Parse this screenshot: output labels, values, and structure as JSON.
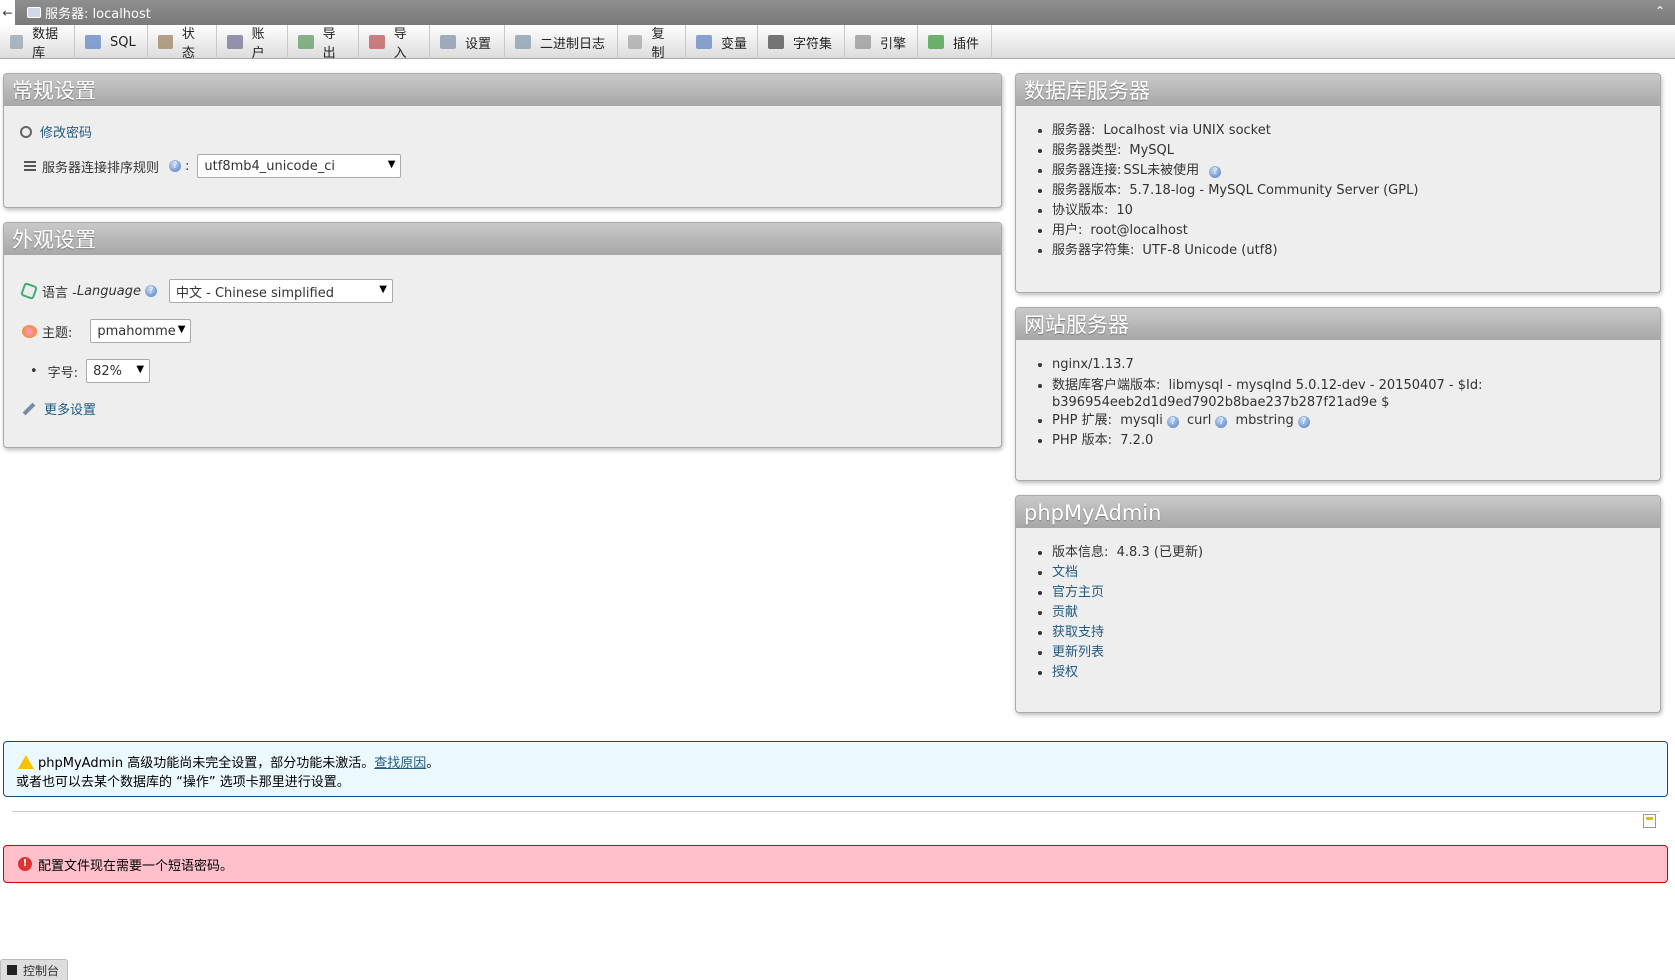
{
  "topbar": {
    "back_glyph": "←",
    "title": "服务器: localhost",
    "collapse_glyph": "⌃"
  },
  "menu": [
    {
      "label": "数据库",
      "icon": "database-icon",
      "color": "#9aa6b4"
    },
    {
      "label": "SQL",
      "icon": "sql-icon",
      "color": "#6a8bc5"
    },
    {
      "label": "状态",
      "icon": "status-icon",
      "color": "#a08a6a"
    },
    {
      "label": "账户",
      "icon": "accounts-icon",
      "color": "#7a7a9a"
    },
    {
      "label": "导出",
      "icon": "export-icon",
      "color": "#6aa06a"
    },
    {
      "label": "导入",
      "icon": "import-icon",
      "color": "#c06060"
    },
    {
      "label": "设置",
      "icon": "settings-wrench-icon",
      "color": "#8a9ab0"
    },
    {
      "label": "二进制日志",
      "icon": "binlog-icon",
      "color": "#8aa0b0"
    },
    {
      "label": "复制",
      "icon": "replication-icon",
      "color": "#aaaaaa"
    },
    {
      "label": "变量",
      "icon": "variables-icon",
      "color": "#6a8bc5"
    },
    {
      "label": "字符集",
      "icon": "charset-icon",
      "color": "#555555"
    },
    {
      "label": "引擎",
      "icon": "engine-icon",
      "color": "#9a9a9a"
    },
    {
      "label": "插件",
      "icon": "plugin-icon",
      "color": "#4aa04a"
    }
  ],
  "general": {
    "title": "常规设置",
    "change_password": "修改密码",
    "collation_label": "服务器连接排序规则",
    "collation_colon": ":",
    "collation_value": "utf8mb4_unicode_ci"
  },
  "appearance": {
    "title": "外观设置",
    "language_label": "语言 - ",
    "language_label_en": "Language",
    "language_value": "中文 - Chinese simplified",
    "theme_label": "主题:",
    "theme_value": "pmahomme",
    "font_label": "字号:",
    "font_value": "82%",
    "more_settings": "更多设置"
  },
  "db_server": {
    "title": "数据库服务器",
    "items": [
      {
        "label": "服务器:",
        "value": "Localhost via UNIX socket"
      },
      {
        "label": "服务器类型:",
        "value": "MySQL"
      },
      {
        "label": "服务器连接:",
        "value": "SSL未被使用"
      },
      {
        "label": "服务器版本:",
        "value": "5.7.18-log - MySQL Community Server (GPL)"
      },
      {
        "label": "协议版本:",
        "value": "10"
      },
      {
        "label": "用户:",
        "value": "root@localhost"
      },
      {
        "label": "服务器字符集:",
        "value": "UTF-8 Unicode (utf8)"
      }
    ]
  },
  "web_server": {
    "title": "网站服务器",
    "nginx": "nginx/1.13.7",
    "client_label": "数据库客户端版本:",
    "client_value": "libmysql - mysqlnd 5.0.12-dev - 20150407 - $Id:",
    "client_value2": "b396954eeb2d1d9ed7902b8bae237b287f21ad9e $",
    "ext_label": "PHP 扩展:",
    "ext1": "mysqli",
    "ext2": "curl",
    "ext3": "mbstring",
    "php_label": "PHP 版本:",
    "php_value": "7.2.0"
  },
  "pma": {
    "title": "phpMyAdmin",
    "version_label": "版本信息:",
    "version_value": "4.8.3 (已更新)",
    "links": [
      "文档",
      "官方主页",
      "贡献",
      "获取支持",
      "更新列表",
      "授权"
    ]
  },
  "notice": {
    "line1_pre": "phpMyAdmin 高级功能尚未完全设置，部分功能未激活。",
    "line1_link": "查找原因",
    "line1_post": "。",
    "line2": "或者也可以去某个数据库的 “操作” 选项卡那里进行设置。"
  },
  "error": {
    "text": "配置文件现在需要一个短语密码。",
    "icon_glyph": "!"
  },
  "console": {
    "label": "控制台"
  },
  "help_glyph": "?"
}
